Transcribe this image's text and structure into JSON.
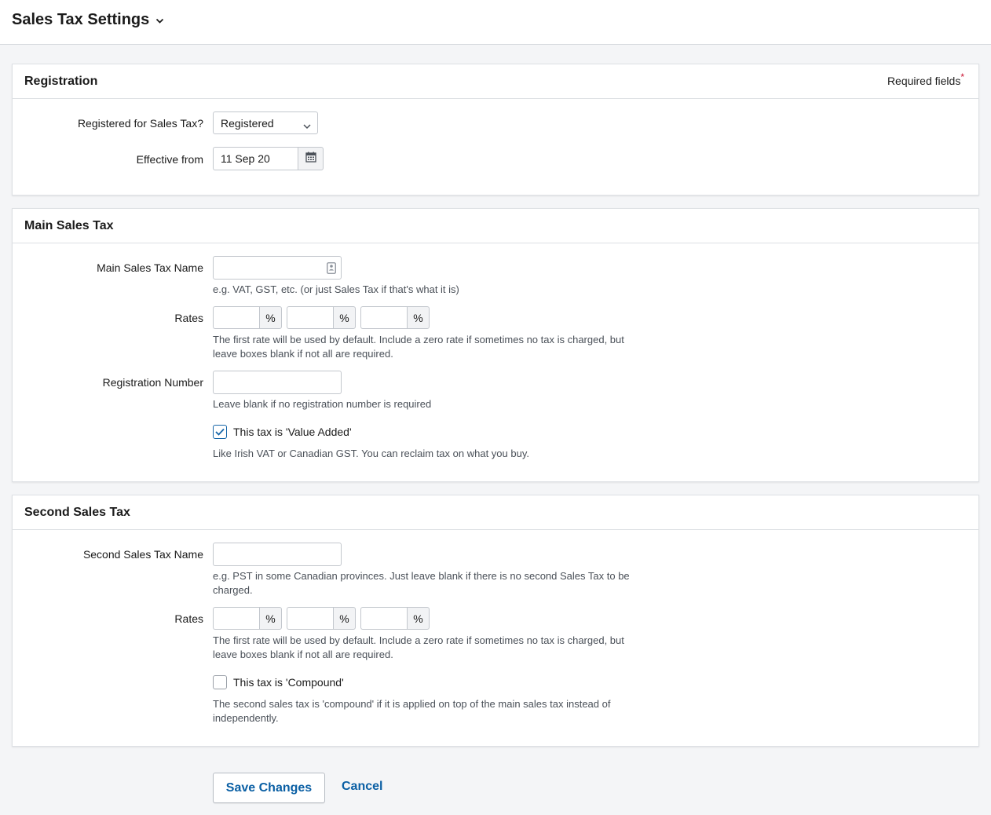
{
  "header": {
    "title": "Sales Tax Settings"
  },
  "registration": {
    "title": "Registration",
    "required_note": "Required fields",
    "required_star": "*",
    "registered_label": "Registered for Sales Tax?",
    "registered_value": "Registered",
    "effective_label": "Effective from",
    "effective_value": "11 Sep 20"
  },
  "main_tax": {
    "title": "Main Sales Tax",
    "name_label": "Main Sales Tax Name",
    "name_value": "",
    "name_help": "e.g. VAT, GST, etc. (or just Sales Tax if that's what it is)",
    "rates_label": "Rates",
    "rates": [
      "",
      "",
      ""
    ],
    "percent": "%",
    "rates_help": "The first rate will be used by default. Include a zero rate if sometimes no tax is charged, but leave boxes blank if not all are required.",
    "regnum_label": "Registration Number",
    "regnum_value": "",
    "regnum_help": "Leave blank if no registration number is required",
    "value_added_label": "This tax is 'Value Added'",
    "value_added_checked": true,
    "value_added_help": "Like Irish VAT or Canadian GST. You can reclaim tax on what you buy."
  },
  "second_tax": {
    "title": "Second Sales Tax",
    "name_label": "Second Sales Tax Name",
    "name_value": "",
    "name_help": "e.g. PST in some Canadian provinces. Just leave blank if there is no second Sales Tax to be charged.",
    "rates_label": "Rates",
    "rates": [
      "",
      "",
      ""
    ],
    "percent": "%",
    "rates_help": "The first rate will be used by default. Include a zero rate if sometimes no tax is charged, but leave boxes blank if not all are required.",
    "compound_label": "This tax is 'Compound'",
    "compound_checked": false,
    "compound_help": "The second sales tax is 'compound' if it is applied on top of the main sales tax instead of independently."
  },
  "actions": {
    "save_label": "Save Changes",
    "cancel_label": "Cancel"
  },
  "colors": {
    "link": "#0a5fa4",
    "required_star": "#c8102e",
    "checkbox_check": "#1565a8"
  },
  "icons": {
    "title_dropdown": "chevron-down-icon",
    "calendar": "calendar-icon",
    "contact": "contact-card-icon",
    "check": "check-icon"
  }
}
